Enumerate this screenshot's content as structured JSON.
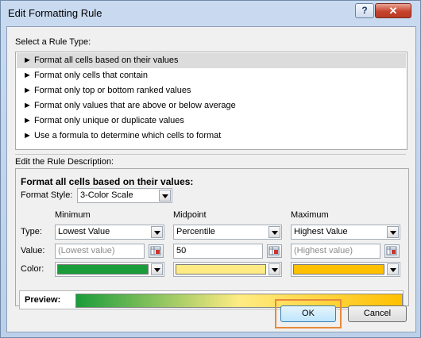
{
  "window": {
    "title": "Edit Formatting Rule",
    "help_label": "?",
    "close_label": "✕"
  },
  "rule_type": {
    "label": "Select a Rule Type:",
    "items": [
      {
        "label": "Format all cells based on their values",
        "selected": true
      },
      {
        "label": "Format only cells that contain",
        "selected": false
      },
      {
        "label": "Format only top or bottom ranked values",
        "selected": false
      },
      {
        "label": "Format only values that are above or below average",
        "selected": false
      },
      {
        "label": "Format only unique or duplicate values",
        "selected": false
      },
      {
        "label": "Use a formula to determine which cells to format",
        "selected": false
      }
    ],
    "bullet": "►"
  },
  "description": {
    "label": "Edit the Rule Description:",
    "heading": "Format all cells based on their values:",
    "format_style_label": "Format Style:",
    "format_style_value": "3-Color Scale",
    "row_labels": {
      "type": "Type:",
      "value": "Value:",
      "color": "Color:"
    },
    "columns": [
      {
        "header": "Minimum",
        "type": "Lowest Value",
        "value": "(Lowest value)",
        "value_is_placeholder": true,
        "color": "#1a9c3a"
      },
      {
        "header": "Midpoint",
        "type": "Percentile",
        "value": "50",
        "value_is_placeholder": false,
        "color": "#ffeb84"
      },
      {
        "header": "Maximum",
        "type": "Highest Value",
        "value": "(Highest value)",
        "value_is_placeholder": true,
        "color": "#ffc000"
      }
    ],
    "preview_label": "Preview:"
  },
  "buttons": {
    "ok": "OK",
    "cancel": "Cancel"
  },
  "colors": {
    "min": "#1a9c3a",
    "mid": "#ffeb84",
    "max": "#ffc000",
    "highlight": "#e98a3c"
  }
}
